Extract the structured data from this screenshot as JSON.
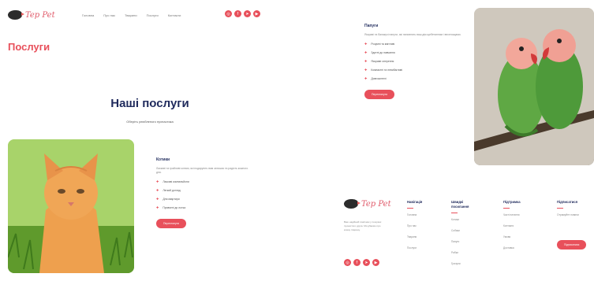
{
  "header": {
    "logo_text": "Tep Pet",
    "nav": [
      "Головна",
      "Про нас",
      "Тварини",
      "Послуги",
      "Контакти"
    ],
    "socials": [
      "instagram-icon",
      "facebook-icon",
      "telegram-icon",
      "youtube-icon"
    ]
  },
  "page_title": "Послуги",
  "section": {
    "title": "Наші послуги",
    "subtitle": "Оберіть улюбленого пухнастика"
  },
  "cat_card": {
    "title": "Котики",
    "description": "Ласкаві та грайливі котики, які подарують вам затишок та радість кожного дня.",
    "bullets": [
      "Ласкаві компаньйони",
      "Легкий догляд",
      "Для квартири",
      "Привчені до лотка"
    ],
    "button": "Переглянути"
  },
  "parrot_card": {
    "title": "Папуги",
    "description": "Яскраві та балакучі папуги, які наповнять ваш дім щебетанням і веселощами.",
    "bullets": [
      "Розумні та кмітливі",
      "Здатні до навчання",
      "Яскраве оперення",
      "Компактні та невибагливі",
      "Довгожителі"
    ],
    "button": "Переглянути"
  },
  "footer": {
    "logo_text": "Tep Pet",
    "description": "Ваш надійний помічник у пошуках пухнастого друга. Ми дбаємо про кожну тварину.",
    "columns": [
      {
        "title": "Навігація",
        "items": [
          "Головна",
          "Про нас",
          "Тварини",
          "Послуги"
        ]
      },
      {
        "title": "Швидкі посилання",
        "items": [
          "Котики",
          "Собаки",
          "Папуги",
          "Рибки",
          "Гризуни"
        ]
      },
      {
        "title": "Підтримка",
        "items": [
          "Часті питання",
          "Контакти",
          "Умови",
          "Доставка"
        ]
      },
      {
        "title": "Підписатися",
        "items": [
          "Отримуйте новини"
        ]
      }
    ],
    "subscribe_button": "Підписатися"
  },
  "colors": {
    "accent": "#e8505b",
    "heading": "#1f2a5c"
  }
}
